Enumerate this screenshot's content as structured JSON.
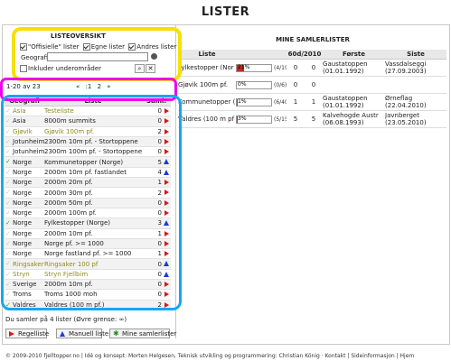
{
  "page": {
    "title": "LISTER"
  },
  "listeoversikt": {
    "title": "LISTEOVERSIKT",
    "filters": [
      {
        "label": "\"Offisielle\" lister",
        "checked": true
      },
      {
        "label": "Egne lister",
        "checked": true
      },
      {
        "label": "Andres lister",
        "checked": true
      }
    ],
    "geo_label": "Geografi",
    "geo_value": "",
    "include_label": "Inkluder underområder",
    "include_checked": false
  },
  "pager": {
    "count": "1-20 av 23",
    "prev": "«",
    "pages": ":1",
    "next": "2",
    "end": "»"
  },
  "lists_table": {
    "headers": {
      "geo": "Geografi",
      "list": "Liste",
      "saml": "Saml."
    },
    "rows": [
      {
        "check": "",
        "geo": "Asia",
        "list": "Testeliste",
        "count": "0",
        "marker": "red",
        "style": "light"
      },
      {
        "check": "",
        "geo": "Asia",
        "list": "8000m summits",
        "count": "0",
        "marker": "red",
        "style": ""
      },
      {
        "check": "",
        "geo": "Gjøvik",
        "list": "Gjøvik 100m pf.",
        "count": "2",
        "marker": "red",
        "style": "olive"
      },
      {
        "check": "",
        "geo": "Jotunheimen",
        "list": "2300m 10m pf. - Stortoppene",
        "count": "0",
        "marker": "red",
        "style": ""
      },
      {
        "check": "",
        "geo": "Jotunheimen",
        "list": "2300m 100m pf. - Stortoppene",
        "count": "0",
        "marker": "red",
        "style": ""
      },
      {
        "check": "green",
        "geo": "Norge",
        "list": "Kommunetopper (Norge)",
        "count": "5",
        "marker": "blue",
        "style": ""
      },
      {
        "check": "",
        "geo": "Norge",
        "list": "2000m 10m pf. fastlandet",
        "count": "4",
        "marker": "blue",
        "style": ""
      },
      {
        "check": "",
        "geo": "Norge",
        "list": "2000m 20m pf.",
        "count": "1",
        "marker": "red",
        "style": ""
      },
      {
        "check": "",
        "geo": "Norge",
        "list": "2000m 30m pf.",
        "count": "2",
        "marker": "red",
        "style": ""
      },
      {
        "check": "",
        "geo": "Norge",
        "list": "2000m 50m pf.",
        "count": "0",
        "marker": "red",
        "style": ""
      },
      {
        "check": "",
        "geo": "Norge",
        "list": "2000m 100m pf.",
        "count": "0",
        "marker": "red",
        "style": ""
      },
      {
        "check": "green",
        "geo": "Norge",
        "list": "Fylkestopper (Norge)",
        "count": "3",
        "marker": "blue",
        "style": ""
      },
      {
        "check": "",
        "geo": "Norge",
        "list": "2000m 10m pf.",
        "count": "1",
        "marker": "red",
        "style": ""
      },
      {
        "check": "",
        "geo": "Norge",
        "list": "Norge pf. >= 1000",
        "count": "0",
        "marker": "red",
        "style": ""
      },
      {
        "check": "",
        "geo": "Norge",
        "list": "Norge fastland pf. >= 1000",
        "count": "1",
        "marker": "red",
        "style": ""
      },
      {
        "check": "",
        "geo": "Ringsaker",
        "list": "Ringsaker 100 pf",
        "count": "0",
        "marker": "blue",
        "style": "olive"
      },
      {
        "check": "",
        "geo": "Stryn",
        "list": "Stryn Fjellbim",
        "count": "0",
        "marker": "blue",
        "style": "olive"
      },
      {
        "check": "",
        "geo": "Sverige",
        "list": "2000m 10m pf.",
        "count": "0",
        "marker": "red",
        "style": ""
      },
      {
        "check": "",
        "geo": "Troms",
        "list": "Troms 1000 moh",
        "count": "0",
        "marker": "red",
        "style": ""
      },
      {
        "check": "green",
        "geo": "Valdres",
        "list": "Valdres (100 m pf.)",
        "count": "2",
        "marker": "red",
        "style": ""
      }
    ]
  },
  "footnote": "Du samler på 4 lister (Øvre grense: ∞)",
  "buttons": {
    "regel": "Regelliste",
    "manuell": "Manuell liste",
    "mine": "Mine samlerlister"
  },
  "mine": {
    "title": "MINE SAMLERLISTER",
    "headers": {
      "liste": "Liste",
      "count": "60d/2010",
      "forste": "Første",
      "siste": "Siste"
    },
    "rows": [
      {
        "name": "Fylkestopper (Nor",
        "pct": "21%",
        "fill": 0.21,
        "frac": "(4/19)",
        "n60": "0",
        "nyear": "0",
        "first": "Gaustatoppen",
        "first_date": "(01.01.1992)",
        "last": "Vassdalseggi",
        "last_date": "(27.09.2003)"
      },
      {
        "name": "Gjøvik 100m pf.",
        "pct": "0%",
        "fill": 0,
        "frac": "(0/6)",
        "n60": "0",
        "nyear": "0",
        "first": "",
        "first_date": "",
        "last": "",
        "last_date": ""
      },
      {
        "name": "Kommunetopper (No",
        "pct": "1%",
        "fill": 0.01,
        "frac": "(6/405)",
        "n60": "1",
        "nyear": "1",
        "first": "Gaustatoppen",
        "first_date": "(01.01.1992)",
        "last": "Ørneflag",
        "last_date": "(22.04.2010)"
      },
      {
        "name": "Valdres (100 m pf",
        "pct": "3%",
        "fill": 0.03,
        "frac": "(5/154)",
        "n60": "5",
        "nyear": "5",
        "first": "Kalvehogde Austr",
        "first_date": "(06.08.1993)",
        "last": "Javnberget",
        "last_date": "(23.05.2010)"
      }
    ]
  },
  "footer": "© 2009-2010 fjelltopper.no | Idé og konsept: Morten Helgesen, Teknisk utvikling og programmering: Christian König · Kontakt | Sideinformasjon | Hjem",
  "colors": {
    "highlight_yellow": "#f5e000",
    "highlight_magenta": "#ee00ee",
    "highlight_blue": "#18a6ef",
    "marker_red": "#d81818",
    "marker_blue": "#1a3bd8",
    "bar_red": "#c8281a"
  }
}
